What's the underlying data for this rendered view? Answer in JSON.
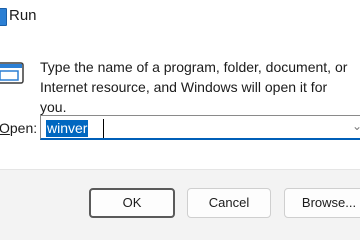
{
  "title": {
    "text": "Run",
    "icon": "run-app-icon"
  },
  "body": {
    "icon": "run-dialog-icon",
    "description": "Type the name of a program, folder, document, or Internet resource, and Windows will open it for you."
  },
  "open_field": {
    "label_prefix": "O",
    "label_rest": "pen:",
    "value": "winver",
    "dropdown_icon": "chevron-down-icon"
  },
  "buttons": {
    "ok": "OK",
    "cancel": "Cancel",
    "browse": "Browse..."
  },
  "colors": {
    "accent": "#0067c0",
    "button_bar": "#f3f3f3"
  }
}
